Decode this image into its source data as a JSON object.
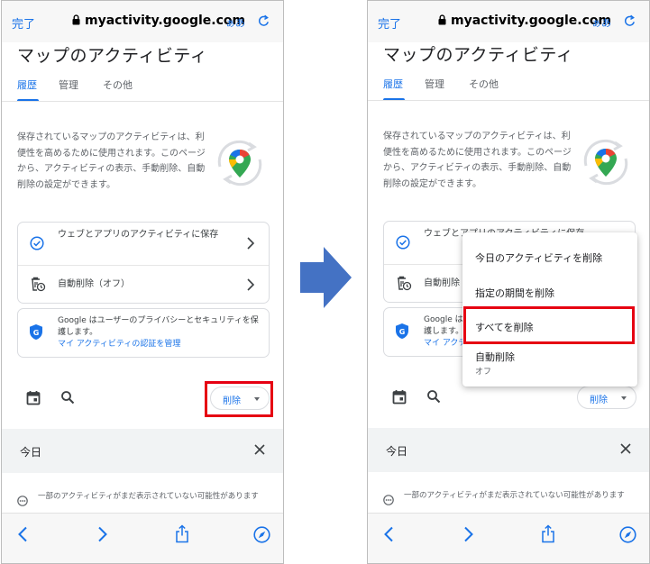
{
  "browser": {
    "done_label": "完了",
    "url": "myactivity.google.com",
    "text_size_label": "ぁあ"
  },
  "page": {
    "title": "マップのアクティビティ",
    "tabs": [
      "履歴",
      "管理",
      "その他"
    ],
    "description": "保存されているマップのアクティビティは、利便性を高めるために使用されます。このページから、アクティビティの表示、手動削除、自動削除の設定ができます。",
    "settings_rows": [
      {
        "label": "ウェブとアプリのアクティビティに保存",
        "icon": "check-circle-icon"
      },
      {
        "label": "自動削除（オフ）",
        "icon": "auto-delete-icon"
      }
    ],
    "privacy": {
      "text": "Google はユーザーのプライバシーとセキュリティを保護します。",
      "link": "マイ アクティビティの認証を管理"
    },
    "delete_button_label": "削除",
    "today_label": "今日",
    "notice": "一部のアクティビティがまだ表示されていない可能性があります"
  },
  "delete_menu": {
    "items": [
      {
        "label": "今日のアクティビティを削除"
      },
      {
        "label": "指定の期間を削除"
      },
      {
        "label": "すべてを削除",
        "highlighted": true
      },
      {
        "label": "自動削除",
        "sublabel": "オフ"
      }
    ]
  },
  "colors": {
    "accent": "#1a73e8",
    "highlight_box": "#e60012",
    "arrow": "#4472c4"
  }
}
